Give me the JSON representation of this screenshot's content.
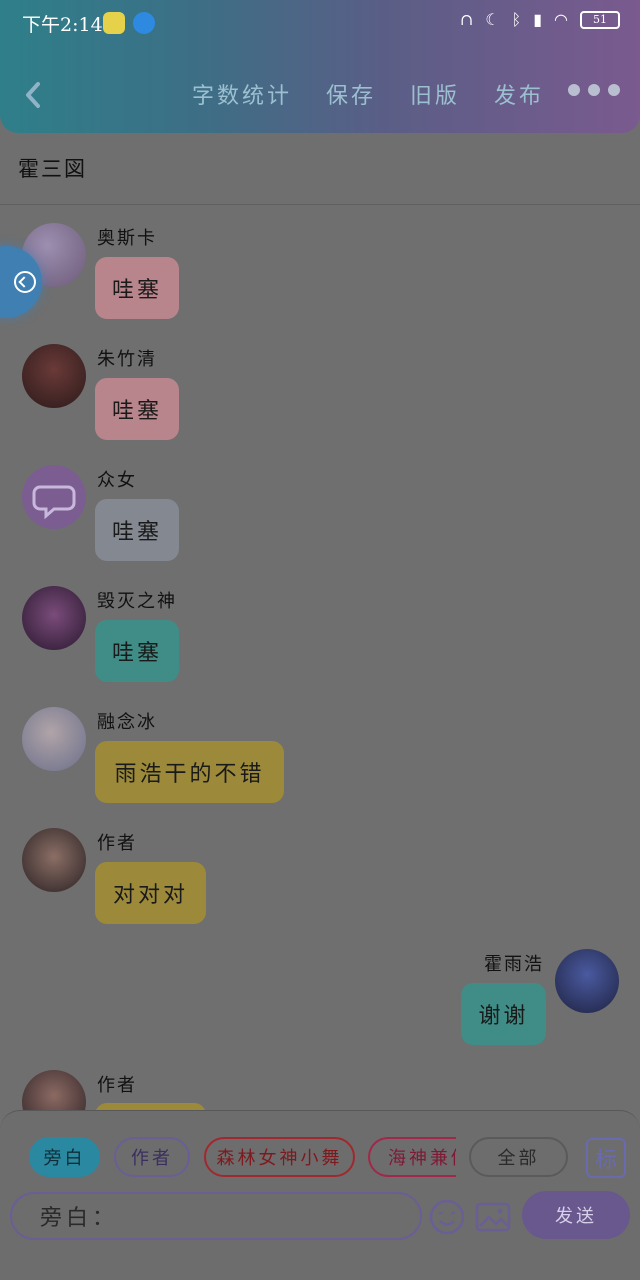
{
  "status": {
    "time": "下午2:14",
    "battery": "51"
  },
  "nav": {
    "actions": [
      "字数统计",
      "保存",
      "旧版",
      "发布"
    ]
  },
  "page": {
    "title": "霍三図"
  },
  "messages": [
    {
      "name": "奥斯卡",
      "text": "哇塞",
      "bubble_color": "#b9858d",
      "side": "left"
    },
    {
      "name": "朱竹清",
      "text": "哇塞",
      "bubble_color": "#b9858d",
      "side": "left"
    },
    {
      "name": "众女",
      "text": "哇塞",
      "bubble_color": "#848891",
      "side": "left"
    },
    {
      "name": "毁灭之神",
      "text": "哇塞",
      "bubble_color": "#3f8d86",
      "side": "left"
    },
    {
      "name": "融念冰",
      "text": "雨浩干的不错",
      "bubble_color": "#9c8a3a",
      "side": "left"
    },
    {
      "name": "作者",
      "text": "对对对",
      "bubble_color": "#9c8a3a",
      "side": "left"
    },
    {
      "name": "霍雨浩",
      "text": "谢谢",
      "bubble_color": "#3f8d86",
      "side": "right"
    },
    {
      "name": "作者",
      "text": "",
      "bubble_color": "#9c8a3a",
      "side": "left"
    }
  ],
  "chips": [
    {
      "label": "旁白",
      "color": "#2a88a1",
      "filled": true
    },
    {
      "label": "作者",
      "color": "#6a5e95",
      "filled": false
    },
    {
      "label": "森林女神小舞",
      "color": "#a1282e",
      "filled": false
    },
    {
      "label": "海神兼修",
      "color": "#a1284a",
      "filled": false
    },
    {
      "label": "全部",
      "color": "#5a5a5a",
      "filled": false
    }
  ],
  "mark_button": "标",
  "input": {
    "placeholder": "旁白："
  },
  "send_label": "发送"
}
